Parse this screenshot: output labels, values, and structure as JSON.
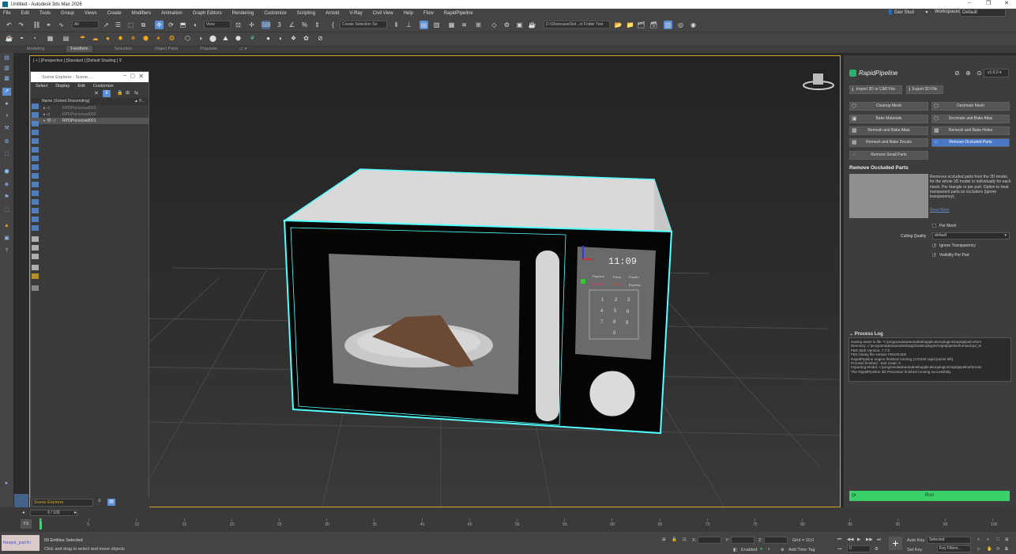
{
  "app": {
    "title": "Untitled - Autodesk 3ds Max 2026",
    "user": "Dev Stud",
    "workspaces_label": "Workspaces:",
    "workspace": "Default"
  },
  "menu": [
    "File",
    "Edit",
    "Tools",
    "Group",
    "Views",
    "Create",
    "Modifiers",
    "Animation",
    "Graph Editors",
    "Rendering",
    "Customize",
    "Scripting",
    "Arnold",
    "V-Ray",
    "Civil View",
    "Help",
    "Flow",
    "RapidPipeline"
  ],
  "toolbar": {
    "filter": "All",
    "view": "View",
    "selection_set": "Create Selection Se",
    "project_path": "D:\\ShowcaseDiet...ct Folder Test"
  },
  "ribbon": {
    "tabs": [
      "Modeling",
      "Freeform",
      "Selection",
      "Object Paint",
      "Populate"
    ],
    "active": "Freeform"
  },
  "viewport": {
    "label": "[ + ] [Perspective ] [Standard ] [Default Shading ]",
    "filter_icon": "funnel-icon",
    "microwave": {
      "clock": "11:09",
      "control_labels": [
        "Popcorn",
        "Pizza",
        "Frozen",
        "Defrost",
        "Clock",
        "Express"
      ],
      "keypad": [
        "1",
        "2",
        "3",
        "4",
        "5",
        "6",
        "7",
        "8",
        "9",
        "0"
      ]
    }
  },
  "scene_explorer": {
    "title": "Scene Explorer - Scene ...",
    "menu": [
      "Select",
      "Display",
      "Edit",
      "Customize"
    ],
    "column_header": "Name (Sorted Descending)",
    "column_header_right": "▲ F...",
    "rows": [
      {
        "name": "RPDProcessed003",
        "selected": false
      },
      {
        "name": "RPDProcessed002",
        "selected": false
      },
      {
        "name": "RPDProcessed001",
        "selected": true
      }
    ],
    "bottom_selector": "Scene Explorer"
  },
  "rapidpipeline": {
    "brand": "RapidPipeline",
    "version": "v1.0.0",
    "import_label": "Import 3D or CAD File",
    "export_label": "Export 3D File",
    "buttons": [
      {
        "label": "Cleanup Mesh",
        "active": false
      },
      {
        "label": "Decimate Mesh",
        "active": false
      },
      {
        "label": "Bake Materials",
        "active": false
      },
      {
        "label": "Decimate and Bake Atlas",
        "active": false
      },
      {
        "label": "Remesh and Bake Atlas",
        "active": false
      },
      {
        "label": "Remesh and Bake Holes",
        "active": false
      },
      {
        "label": "Remesh and Bake Decals",
        "active": false
      },
      {
        "label": "Remove Occluded Parts",
        "active": true
      },
      {
        "label": "Remove Small Parts",
        "active": false
      }
    ],
    "section_title": "Remove Occluded Parts",
    "description": "Removes occluded parts from the 3D model, for the whole 3D model or individually for each mesh. Per triangle or per part. Option to treat transparent parts as occluders (ignore transparency).",
    "read_more": "Read More",
    "per_mesh_label": "Per Mesh",
    "per_mesh": false,
    "culling_quality_label": "Culling Quality",
    "culling_quality": "default",
    "ignore_transparency_label": "Ignore Transparency",
    "ignore_transparency": true,
    "visibility_per_part_label": "Visibility Per Part",
    "visibility_per_part": true,
    "log_title": "Process Log",
    "log": [
      "Saving asset to file \"c:\\programdata\\autodesk\\applicationplugins\\rapidpipelineforn",
      "Directory: c:\\programdata\\autodesk\\applicationplugins\\rapidpipelineformax\\rpd_te",
      "FBX SDK Version: 7.7.0",
      "FBX binary file version FBX20.000",
      "RapidPipeline engine finished running (170226 rapid points left).",
      "Process finished - Exit Code: 0.",
      "Importing Model: c:\\programdata\\autodesk\\applicationplugins\\rapidpipelineformax",
      "The RapidPipeline 3D Processor finished running successfully."
    ],
    "run_label": "Run"
  },
  "timeline": {
    "frame_field": "0 / 100",
    "ticks": [
      "0",
      "5",
      "10",
      "15",
      "20",
      "25",
      "30",
      "35",
      "40",
      "45",
      "50",
      "55",
      "60",
      "65",
      "70",
      "75",
      "80",
      "85",
      "90",
      "95",
      "100"
    ]
  },
  "status": {
    "script_field": "hoops_path:",
    "selection": "59 Entities Selected",
    "prompt": "Click and drag to select and move objects",
    "x_label": "X:",
    "y_label": "Y:",
    "z_label": "Z:",
    "grid": "Grid = 10,0",
    "enabled_label": "Enabled:",
    "add_time_tag": "Add Time Tag",
    "auto_key": "Auto Key",
    "selected": "Selected",
    "set_key": "Set Key",
    "key_filters": "Key Filters...",
    "key_field": "0"
  }
}
